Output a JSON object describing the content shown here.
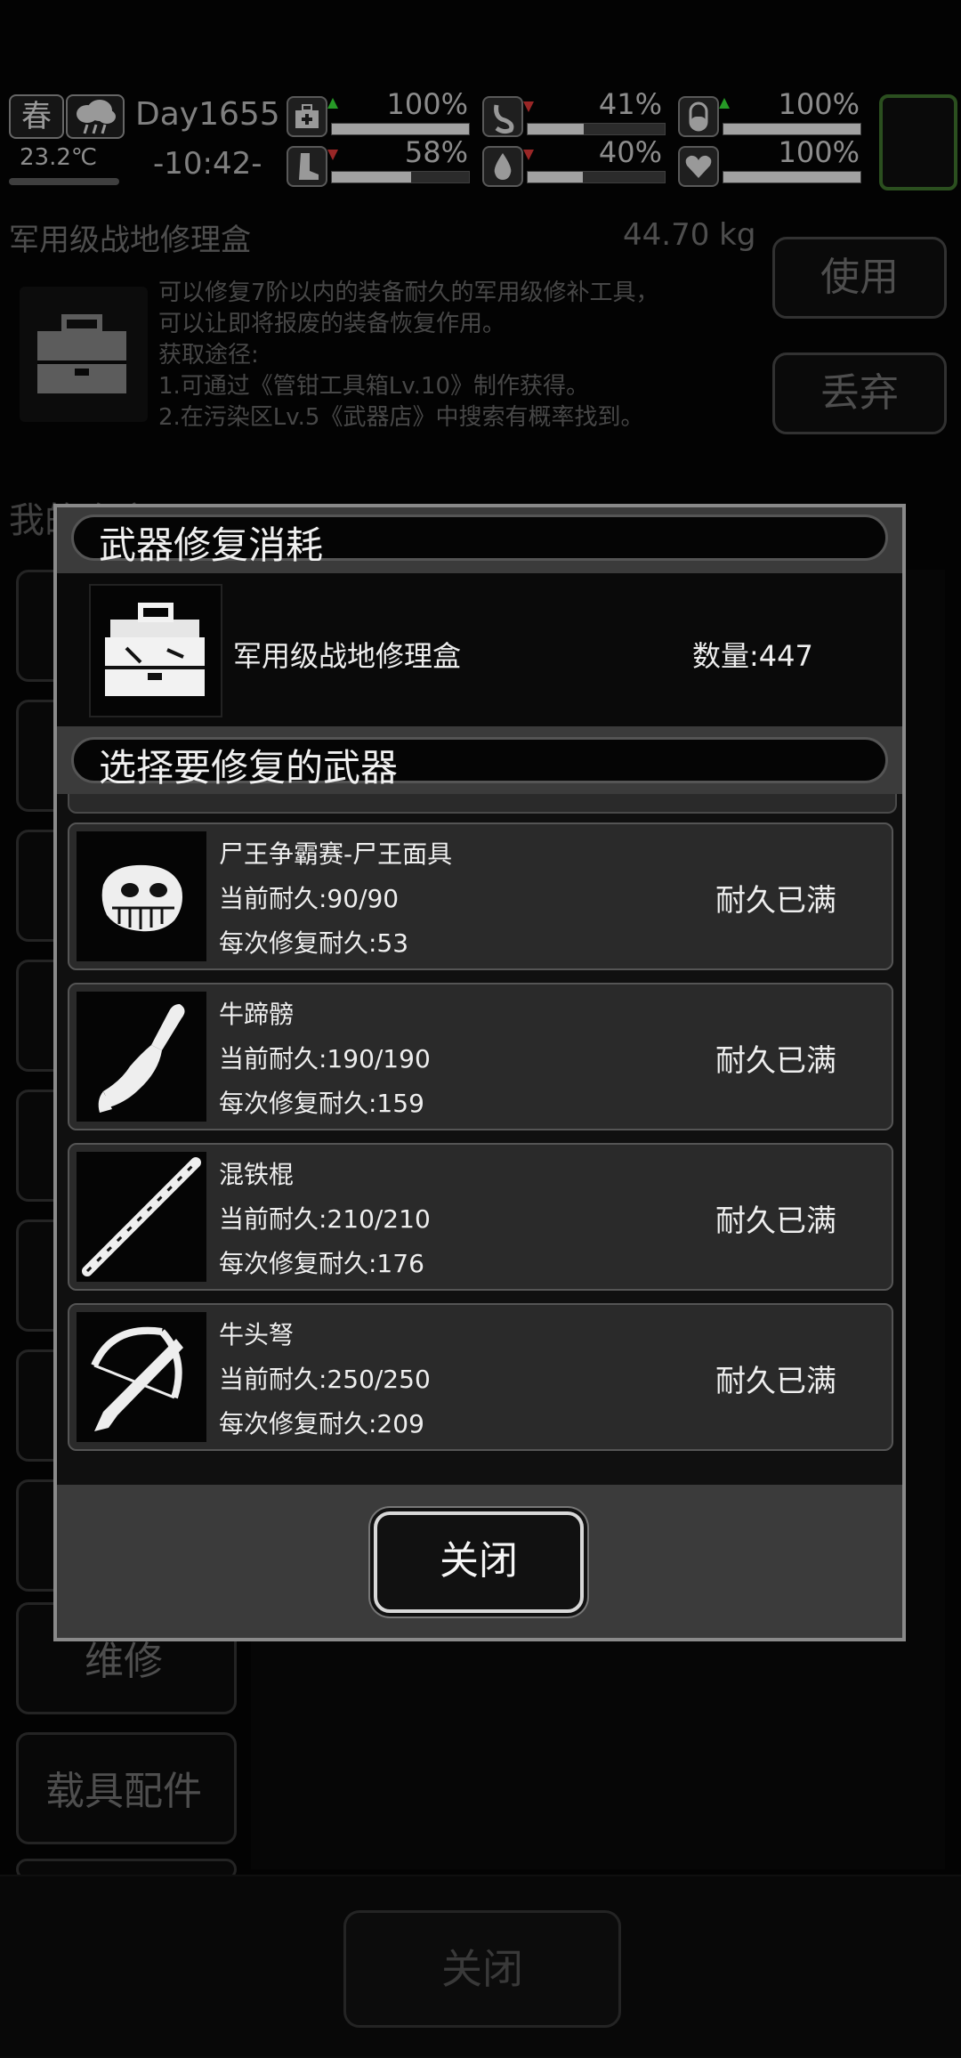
{
  "hud": {
    "season": "春",
    "temperature": "23.2℃",
    "day": "Day1655",
    "time": "-10:42-",
    "stats": [
      {
        "icon": "medkit-icon",
        "pct": "100%",
        "trend": "up",
        "fill": 1.0
      },
      {
        "icon": "stomach-icon",
        "pct": "41%",
        "trend": "down",
        "fill": 0.41
      },
      {
        "icon": "pill-icon",
        "pct": "100%",
        "trend": "up",
        "fill": 1.0
      },
      {
        "icon": "boot-icon",
        "pct": "58%",
        "trend": "down",
        "fill": 0.58
      },
      {
        "icon": "water-drop-icon",
        "pct": "40%",
        "trend": "down",
        "fill": 0.4
      },
      {
        "icon": "heart-icon",
        "pct": "100%",
        "trend": "none",
        "fill": 1.0
      }
    ]
  },
  "item": {
    "name": "军用级战地修理盒",
    "weight": "44.70 kg",
    "description": "可以修复7阶以内的装备耐久的军用级修补工具，\n可以让即将报废的装备恢复作用。\n获取途径:\n1.可通过《管钳工具箱Lv.10》制作获得。\n2.在污染区Lv.5《武器店》中搜索有概率找到。",
    "use_label": "使用",
    "discard_label": "丢弃",
    "warehouse_label": "我的仓库"
  },
  "background_menu": {
    "repair_label": "维修",
    "vehicle_parts_label": "载具配件",
    "close_label": "关闭"
  },
  "modal": {
    "title": "武器修复消耗",
    "consume": {
      "name": "军用级战地修理盒",
      "quantity": "数量:447"
    },
    "select_title": "选择要修复的武器",
    "weapons": [
      {
        "name": "尸王争霸赛-尸王面具",
        "current": "当前耐久:90/90",
        "repair": "每次修复耐久:53",
        "status": "耐久已满",
        "icon": "skull-mask-icon"
      },
      {
        "name": "牛蹄髈",
        "current": "当前耐久:190/190",
        "repair": "每次修复耐久:159",
        "status": "耐久已满",
        "icon": "ox-hoof-club-icon"
      },
      {
        "name": "混铁棍",
        "current": "当前耐久:210/210",
        "repair": "每次修复耐久:176",
        "status": "耐久已满",
        "icon": "iron-staff-icon"
      },
      {
        "name": "牛头弩",
        "current": "当前耐久:250/250",
        "repair": "每次修复耐久:209",
        "status": "耐久已满",
        "icon": "crossbow-icon"
      }
    ],
    "close_label": "关闭"
  }
}
